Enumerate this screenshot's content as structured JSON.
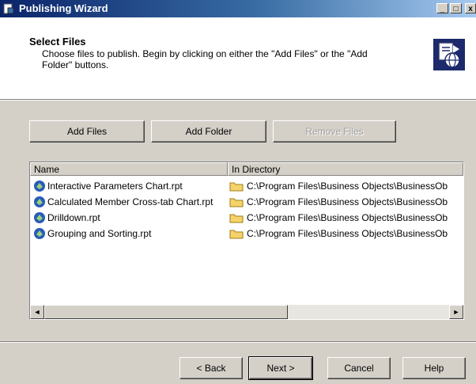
{
  "window": {
    "title": "Publishing Wizard",
    "min_glyph": "_",
    "max_glyph": "□",
    "close_glyph": "x"
  },
  "header": {
    "title": "Select Files",
    "description": "Choose files to publish.  Begin by clicking on either the \"Add Files\" or the \"Add Folder\" buttons."
  },
  "actions": {
    "add_files": "Add Files",
    "add_folder": "Add Folder",
    "remove_files": "Remove Files"
  },
  "list": {
    "columns": [
      "Name",
      "In Directory"
    ],
    "rows": [
      {
        "name": "Interactive Parameters Chart.rpt",
        "dir": "C:\\Program Files\\Business Objects\\BusinessOb"
      },
      {
        "name": "Calculated Member Cross-tab Chart.rpt",
        "dir": "C:\\Program Files\\Business Objects\\BusinessOb"
      },
      {
        "name": "Drilldown.rpt",
        "dir": "C:\\Program Files\\Business Objects\\BusinessOb"
      },
      {
        "name": "Grouping and Sorting.rpt",
        "dir": "C:\\Program Files\\Business Objects\\BusinessOb"
      }
    ],
    "scroll_left": "◄",
    "scroll_right": "►"
  },
  "footer": {
    "back": "< Back",
    "next": "Next >",
    "cancel": "Cancel",
    "help": "Help"
  }
}
